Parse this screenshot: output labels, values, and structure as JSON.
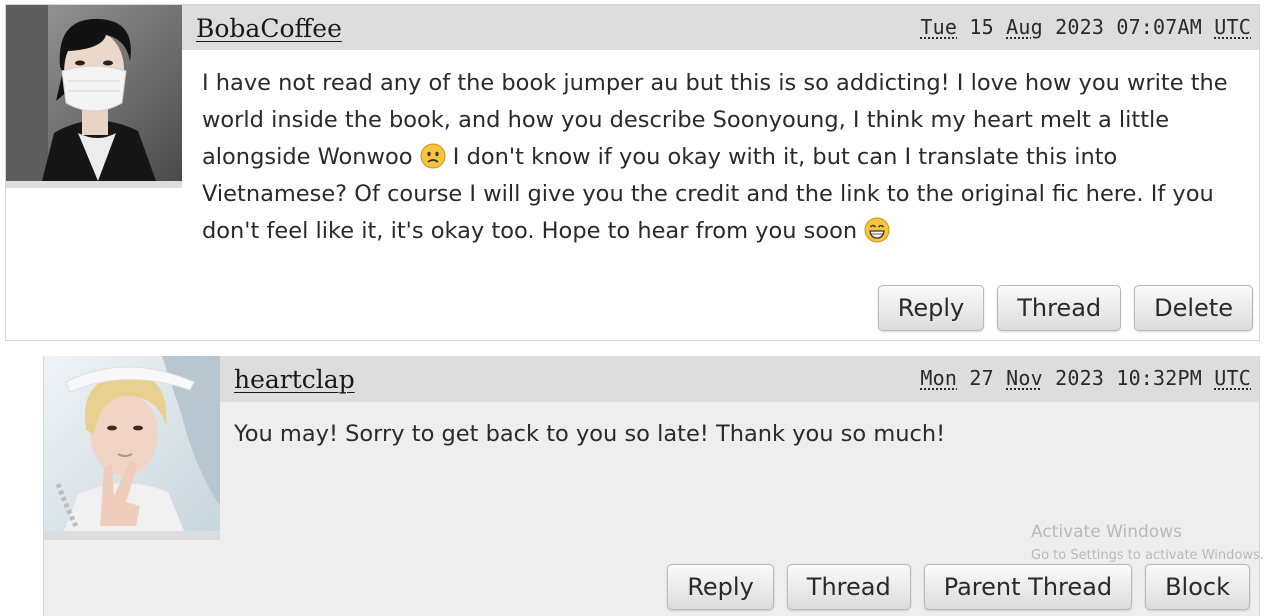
{
  "comments": [
    {
      "username": "BobaCoffee",
      "date": {
        "weekday": "Tue",
        "day": "15",
        "month": "Aug",
        "year": "2023",
        "time": "07:07AM",
        "tz": "UTC"
      },
      "text_part1": "I have not read any of the book jumper au but this is so addicting! I love how you write the world inside the book, and how you describe Soonyoung, I think my heart melt a little alongside Wonwoo",
      "emoji1": "disappointed-face-emoji",
      "text_part2": " I don't know if you okay with it, but can I translate this into Vietnamese? Of course I will give you the credit and the link to the original fic here. If you don't feel like it, it's okay too. Hope to hear from you soon",
      "emoji2": "grinning-face-emoji",
      "actions": [
        "Reply",
        "Thread",
        "Delete"
      ]
    },
    {
      "username": "heartclap",
      "date": {
        "weekday": "Mon",
        "day": "27",
        "month": "Nov",
        "year": "2023",
        "time": "10:32PM",
        "tz": "UTC"
      },
      "text": "You may! Sorry to get back to you so late! Thank you so much!",
      "actions": [
        "Reply",
        "Thread",
        "Parent Thread",
        "Block"
      ]
    }
  ],
  "watermark": {
    "title": "Activate Windows",
    "subtitle": "Go to Settings to activate Windows."
  },
  "colors": {
    "header_bg": "#dddddd",
    "reply_bg": "#eeeeee",
    "watermark": "#b9b9b9"
  }
}
